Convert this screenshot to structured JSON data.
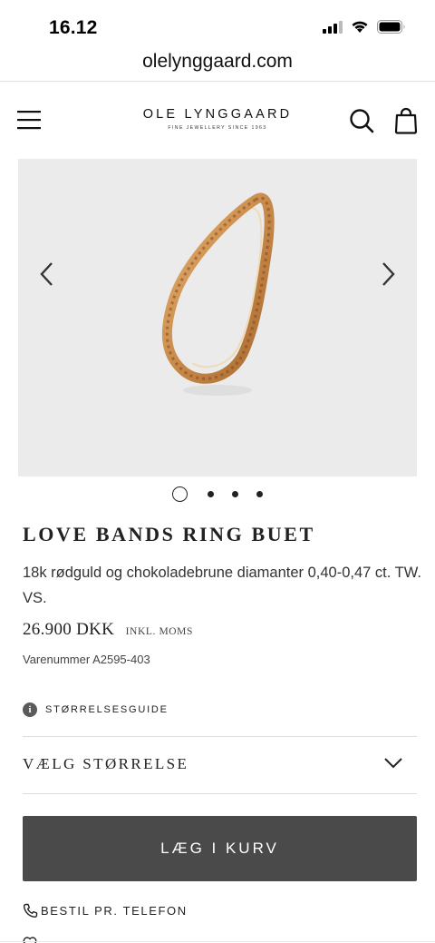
{
  "status_bar": {
    "time": "16.12",
    "icons": [
      "cellular-signal-icon",
      "wifi-icon",
      "battery-icon"
    ]
  },
  "browser": {
    "url": "olelynggaard.com"
  },
  "header": {
    "logo_main": "OLE LYNGGAARD",
    "logo_sub": "FINE JEWELLERY SINCE 1963",
    "icons": [
      "menu-icon",
      "search-icon",
      "bag-icon"
    ]
  },
  "gallery": {
    "image_description_icon": "ring-image",
    "slide_count": 4,
    "active_index": 0,
    "nav_icons": [
      "chevron-left-icon",
      "chevron-right-icon"
    ]
  },
  "product": {
    "title": "LOVE BANDS RING BUET",
    "description": "18k rødguld og chokoladebrune diamanter 0,40-0,47 ct. TW. VS.",
    "price": "26.900 DKK",
    "price_tax_note": "INKL. MOMS",
    "sku": "Varenummer A2595-403"
  },
  "size_guide": {
    "label": "STØRRELSESGUIDE",
    "icon": "info-icon"
  },
  "size_select": {
    "label": "VÆLG STØRRELSE",
    "icon": "chevron-down-icon"
  },
  "cart": {
    "add_label": "LÆG I KURV"
  },
  "phone_order": {
    "label": "BESTIL PR. TELEFON",
    "icon": "phone-icon"
  },
  "colors": {
    "button_bg": "#4a4a4a",
    "gallery_bg": "#ebebeb",
    "gold": "#c98a4a",
    "text": "#222222"
  }
}
